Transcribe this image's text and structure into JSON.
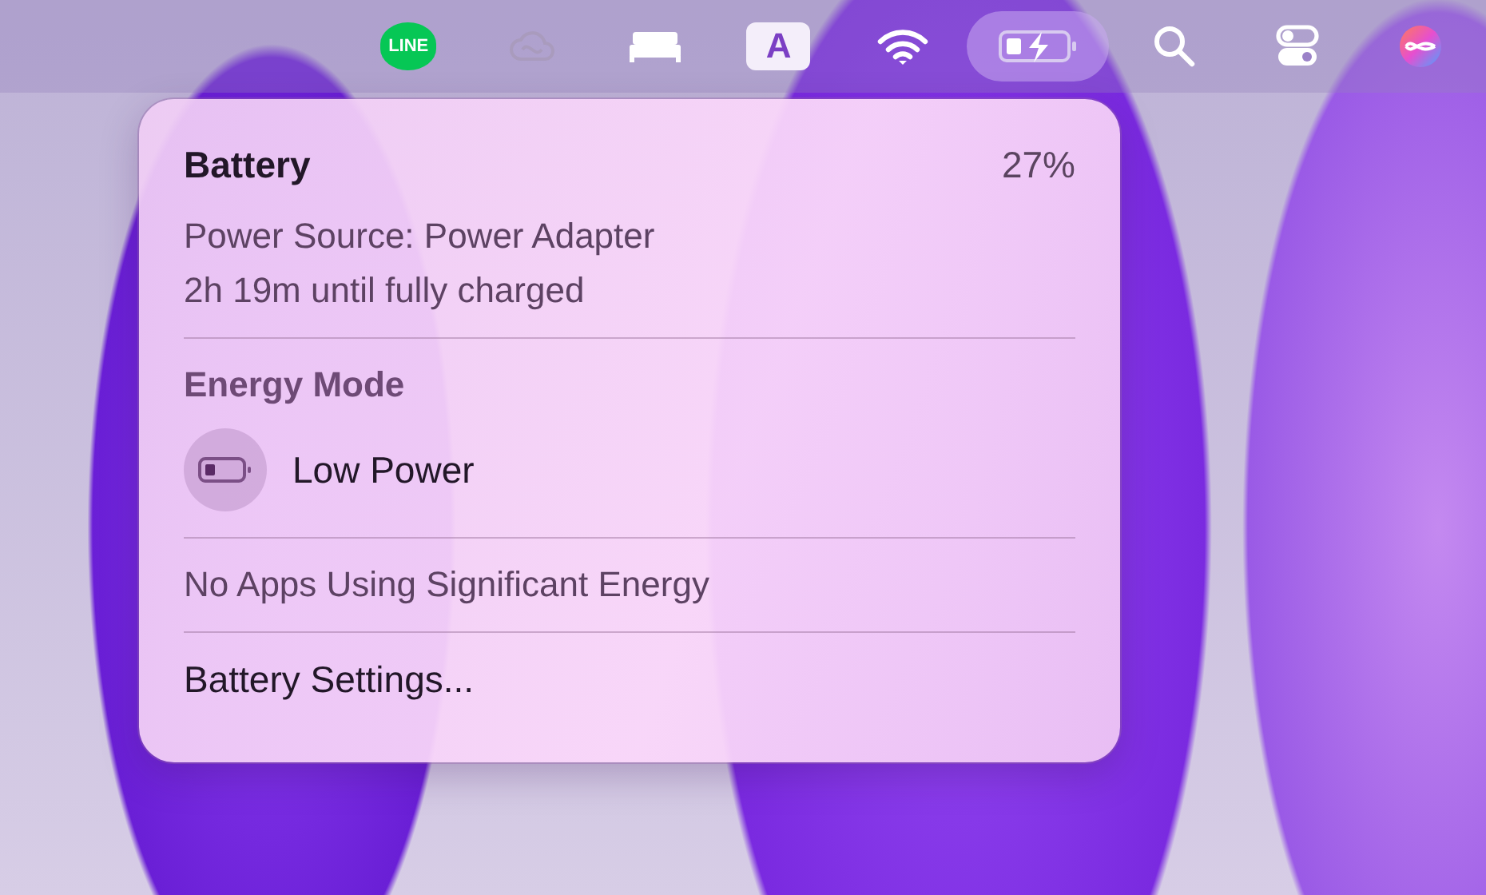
{
  "menu_bar": {
    "items": [
      {
        "kind": "line",
        "label": "LINE",
        "selected": false
      },
      {
        "kind": "cloud",
        "selected": false
      },
      {
        "kind": "bed",
        "selected": false
      },
      {
        "kind": "input",
        "label": "A",
        "selected": false
      },
      {
        "kind": "wifi",
        "selected": false
      },
      {
        "kind": "battery",
        "selected": true
      },
      {
        "kind": "search",
        "selected": false
      },
      {
        "kind": "toggles",
        "selected": false
      },
      {
        "kind": "orb",
        "selected": false
      }
    ]
  },
  "battery_menu": {
    "title": "Battery",
    "percent": "27%",
    "power_source": "Power Source: Power Adapter",
    "time_remaining": "2h 19m until fully charged",
    "energy_mode": {
      "heading": "Energy Mode",
      "options": [
        {
          "label": "Low Power",
          "on": false
        }
      ]
    },
    "apps_note": "No Apps Using Significant Energy",
    "settings_item": "Battery Settings..."
  }
}
